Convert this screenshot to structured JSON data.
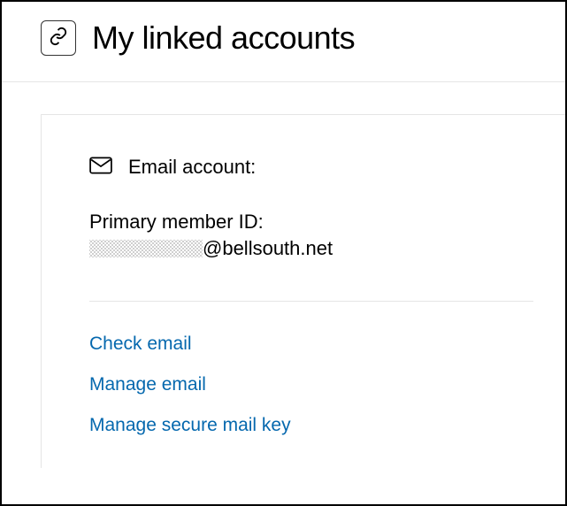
{
  "header": {
    "title": "My linked accounts"
  },
  "card": {
    "section_title": "Email account:",
    "primary_id_label": "Primary member ID:",
    "email_domain": "@bellsouth.net",
    "links": {
      "check_email": "Check email",
      "manage_email": "Manage email",
      "manage_secure_mail_key": "Manage secure mail key"
    }
  }
}
